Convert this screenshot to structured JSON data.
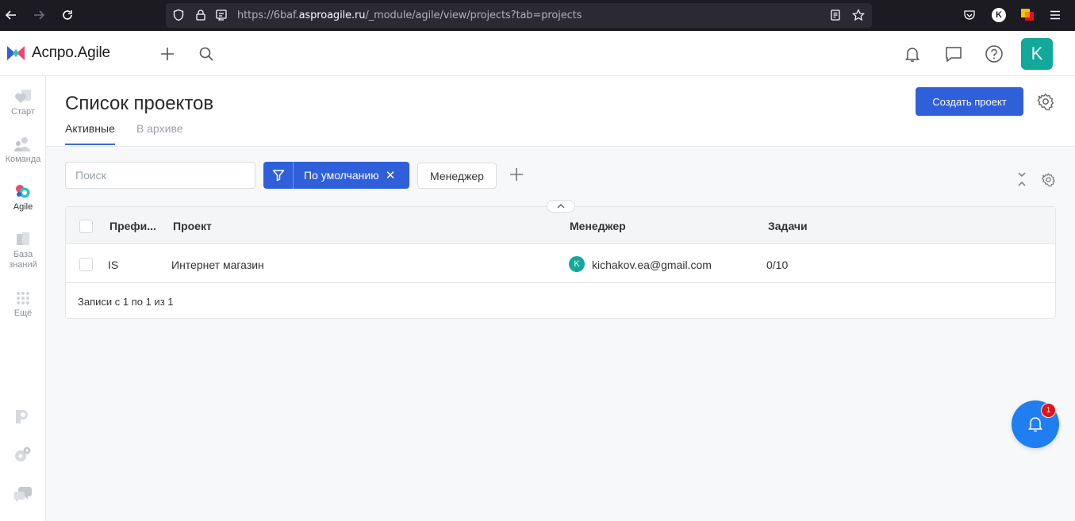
{
  "browser": {
    "url_prefix": "https://6baf.",
    "url_host": "asproagile.ru",
    "url_path": "/_module/agile/view/projects?tab=projects",
    "profile_initial": "K"
  },
  "header": {
    "logo_text": "Аспро.Agile",
    "avatar_initial": "K"
  },
  "sidebar": {
    "items": [
      {
        "label": "Старт"
      },
      {
        "label": "Команда"
      },
      {
        "label": "Agile"
      },
      {
        "label": "База знаний"
      },
      {
        "label": "Ещё"
      }
    ]
  },
  "page": {
    "title": "Список проектов",
    "tabs": [
      {
        "label": "Активные"
      },
      {
        "label": "В архиве"
      }
    ],
    "create_button": "Создать проект"
  },
  "filters": {
    "search_placeholder": "Поиск",
    "active_filter": "По умолчанию",
    "close_glyph": "✕",
    "manager_button": "Менеджер"
  },
  "table": {
    "columns": [
      "Префи...",
      "Проект",
      "Менеджер",
      "Задачи"
    ],
    "rows": [
      {
        "prefix": "IS",
        "project": "Интернет магазин",
        "manager_initial": "K",
        "manager": "kichakov.ea@gmail.com",
        "tasks": "0/10"
      }
    ],
    "footer": "Записи с 1 по 1 из 1"
  },
  "notifications": {
    "badge_count": "1"
  },
  "colors": {
    "accent": "#2f5fd9",
    "avatar": "#12a89a",
    "fab": "#1f7ef0",
    "badge": "#e0121b"
  }
}
